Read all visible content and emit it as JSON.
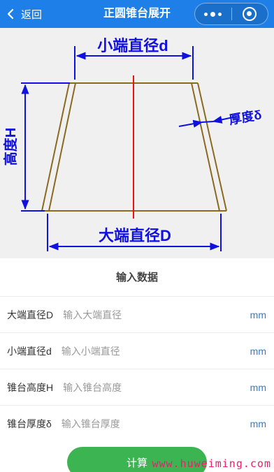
{
  "nav": {
    "back_label": "返回",
    "title": "正圆锥台展开"
  },
  "diagram": {
    "small_diameter_label": "小端直径d",
    "large_diameter_label": "大端直径D",
    "height_label": "高度H",
    "thickness_label": "厚度δ"
  },
  "form": {
    "section_title": "输入数据",
    "rows": [
      {
        "label": "大端直径D",
        "placeholder": "输入大端直径",
        "value": "",
        "unit": "mm"
      },
      {
        "label": "小端直径d",
        "placeholder": "输入小端直径",
        "value": "",
        "unit": "mm"
      },
      {
        "label": "锥台高度H",
        "placeholder": "输入锥台高度",
        "value": "",
        "unit": "mm"
      },
      {
        "label": "锥台厚度δ",
        "placeholder": "输入锥台厚度",
        "value": "",
        "unit": "mm"
      }
    ]
  },
  "calc_button_label": "计算",
  "watermark": "www.huweiming.com",
  "colors": {
    "nav_bg": "#1e7fe8",
    "button_bg": "#3cb451",
    "unit": "#2a7fd6",
    "dimension_line": "#1010e0",
    "cone_outline": "#8a6a20",
    "axis": "#ee1111",
    "watermark": "#e8206e"
  }
}
